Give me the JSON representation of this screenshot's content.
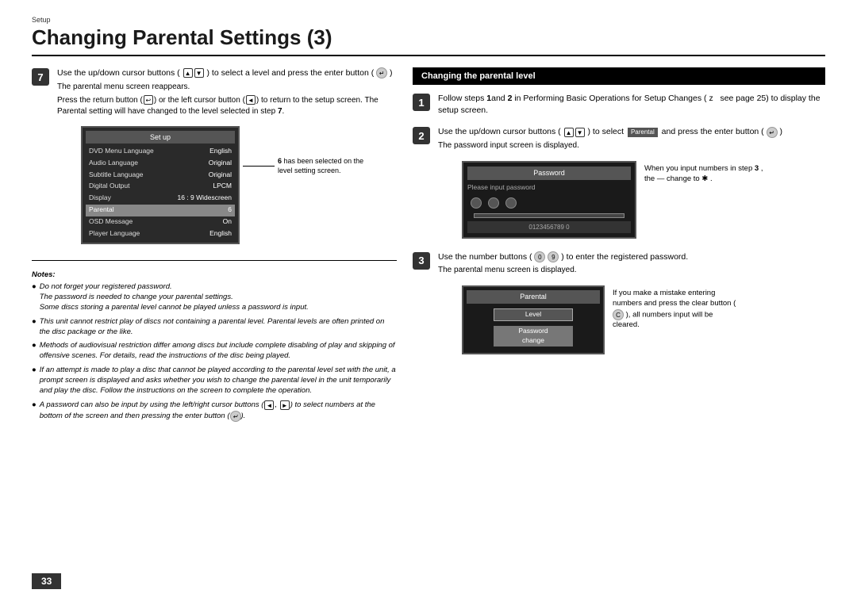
{
  "page": {
    "setup_label": "Setup",
    "title": "Changing Parental Settings (3)",
    "page_number": "33"
  },
  "left": {
    "step7": {
      "number": "7",
      "instruction": "Use the up/down cursor buttons (  ) to select a level and press the enter button (  )",
      "sub_text": "The parental menu screen reappears.",
      "sub_text2": "Press the return button (     ) or the left cursor button (   ) to return to the setup screen. The Parental  setting will have changed to the level selected in step",
      "step_ref": "7",
      "screen": {
        "title": "Set up",
        "rows": [
          {
            "label": "DVD Menu Language",
            "value": "English"
          },
          {
            "label": "Audio Language",
            "value": "Original"
          },
          {
            "label": "Subtitle Language",
            "value": "Original"
          },
          {
            "label": "Digital Output",
            "value": "LPCM"
          },
          {
            "label": "Display",
            "value": "16 : 9 Widescreen"
          },
          {
            "label": "Parental",
            "value": "6",
            "highlighted": true
          },
          {
            "label": "OSD Message",
            "value": "On"
          },
          {
            "label": "Player Language",
            "value": "English"
          }
        ]
      },
      "annotation_number": "6",
      "annotation_text": "has been selected on the level setting screen."
    },
    "notes": {
      "title": "Notes:",
      "items": [
        {
          "bullet": "●",
          "text": "Do not forget your registered password.\nThe password is needed to change your parental settings.\nSome discs storing a parental level cannot be played unless a password is input."
        },
        {
          "bullet": "●",
          "text": "This unit cannot restrict play of discs not containing a parental level. Parental levels are often printed on the disc package or the like."
        },
        {
          "bullet": "●",
          "text": "Methods of audiovisual restriction differ among discs but include complete disabling of play and skipping of offensive scenes. For details, read the instructions of the disc being played."
        },
        {
          "bullet": "●",
          "text": "If an attempt is made to play a disc that cannot be played according to the parental level set with the unit, a prompt screen is displayed and asks whether you wish to change the parental level in the unit temporarily and play the disc. Follow the instructions on the screen to complete the operation."
        },
        {
          "bullet": "●",
          "text": "A password can also be input by using the left/right cursor buttons (   ,    ) to select numbers at the bottom of the screen and then pressing the enter button (   )."
        }
      ]
    }
  },
  "right": {
    "header": "Changing the parental level",
    "step1": {
      "number": "1",
      "text": "Follow steps",
      "step_refs": "1 and 2",
      "text2": "in Performing Basic Operations for Setup Changes (  z  see page 25) to display the setup screen."
    },
    "step2": {
      "number": "2",
      "text": "Use the up/down cursor buttons (    ) to select",
      "select_label": "Parental",
      "text2": "and press the enter button (   )",
      "sub_text": "The password input screen is displayed.",
      "password_screen": {
        "title": "Password",
        "label": "Please input password",
        "numbers": "0123456789 0"
      },
      "annotation": "When you input numbers in step 3 , the — change to ✱ ."
    },
    "step3": {
      "number": "3",
      "text": "Use the number buttons (    ) to enter the registered password.",
      "sub_text": "The parental menu screen is displayed.",
      "parental_screen": {
        "title": "Parental",
        "items": [
          "Level",
          "Password change"
        ]
      },
      "annotation": "If you make a mistake entering numbers and press the clear button (    ), all numbers input will be cleared."
    }
  }
}
